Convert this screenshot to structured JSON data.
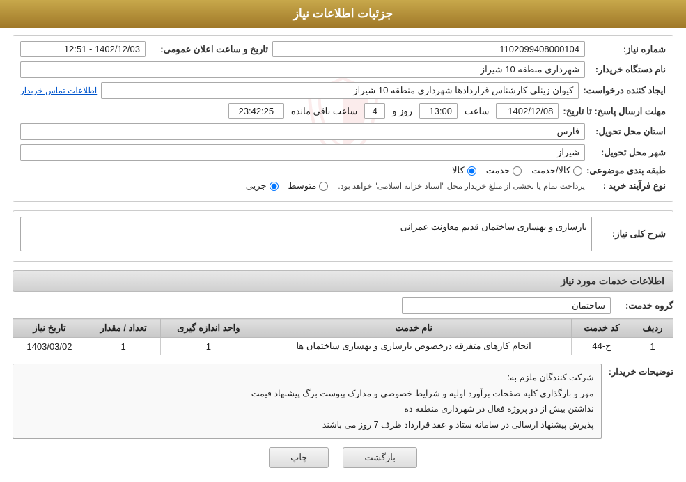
{
  "header": {
    "title": "جزئیات اطلاعات نیاز"
  },
  "fields": {
    "need_number_label": "شماره نیاز:",
    "need_number_value": "1102099408000104",
    "buyer_org_label": "نام دستگاه خریدار:",
    "buyer_org_value": "شهرداری منطقه 10 شیراز",
    "creator_label": "ایجاد کننده درخواست:",
    "creator_value": "کیوان زینلی کارشناس قراردادها شهرداری منطقه 10 شیراز",
    "contact_link": "اطلاعات تماس خریدار",
    "response_deadline_label": "مهلت ارسال پاسخ: تا تاریخ:",
    "response_date": "1402/12/08",
    "response_time_label": "ساعت",
    "response_time": "13:00",
    "days_label": "روز و",
    "days_value": "4",
    "remaining_label": "ساعت باقی مانده",
    "remaining_time": "23:42:25",
    "announce_label": "تاریخ و ساعت اعلان عمومی:",
    "announce_value": "1402/12/03 - 12:51",
    "province_label": "استان محل تحویل:",
    "province_value": "فارس",
    "city_label": "شهر محل تحویل:",
    "city_value": "شیراز",
    "category_label": "طبقه بندی موضوعی:",
    "category_goods": "کالا",
    "category_service": "خدمت",
    "category_goods_service": "کالا/خدمت",
    "purchase_type_label": "نوع فرآیند خرید :",
    "purchase_partial": "جزیی",
    "purchase_medium": "متوسط",
    "purchase_note": "پرداخت تمام یا بخشی از مبلغ خریدار محل \"اسناد خزانه اسلامی\" خواهد بود.",
    "description_title": "شرح کلی نیاز:",
    "description_value": "بازسازی و بهسازی ساختمان قدیم معاونت عمرانی",
    "services_title": "اطلاعات خدمات مورد نیاز",
    "service_group_label": "گروه خدمت:",
    "service_group_value": "ساختمان",
    "table_headers": [
      "ردیف",
      "کد خدمت",
      "نام خدمت",
      "واحد اندازه گیری",
      "تعداد / مقدار",
      "تاریخ نیاز"
    ],
    "table_rows": [
      {
        "row": "1",
        "code": "ح-44",
        "name": "انجام کارهای متفرقه درخصوص بازسازی و بهسازی ساختمان ها",
        "unit": "1",
        "quantity": "1",
        "date": "1403/03/02"
      }
    ],
    "buyer_notes_label": "توضیحات خریدار:",
    "buyer_notes_lines": [
      "شرکت کنندگان ملزم به:",
      "مهر و بارگذاری کلیه صفحات برآورد اولیه و شرایط خصوصی و مدارک پیوست برگ پیشنهاد قیمت",
      "نداشتن بیش از دو پروژه فعال در شهرداری منطقه ده",
      "پذیرش پیشنهاد ارسالی در سامانه ستاد و عقد قرارداد ظرف 7 روز می باشند"
    ],
    "btn_print": "چاپ",
    "btn_back": "بازگشت"
  }
}
